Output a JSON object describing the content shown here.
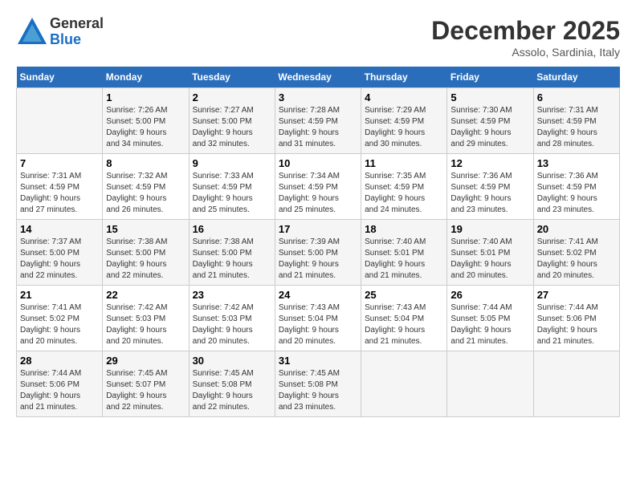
{
  "header": {
    "logo_general": "General",
    "logo_blue": "Blue",
    "month_title": "December 2025",
    "location": "Assolo, Sardinia, Italy"
  },
  "calendar": {
    "days_of_week": [
      "Sunday",
      "Monday",
      "Tuesday",
      "Wednesday",
      "Thursday",
      "Friday",
      "Saturday"
    ],
    "weeks": [
      [
        {
          "day": "",
          "info": ""
        },
        {
          "day": "1",
          "info": "Sunrise: 7:26 AM\nSunset: 5:00 PM\nDaylight: 9 hours\nand 34 minutes."
        },
        {
          "day": "2",
          "info": "Sunrise: 7:27 AM\nSunset: 5:00 PM\nDaylight: 9 hours\nand 32 minutes."
        },
        {
          "day": "3",
          "info": "Sunrise: 7:28 AM\nSunset: 4:59 PM\nDaylight: 9 hours\nand 31 minutes."
        },
        {
          "day": "4",
          "info": "Sunrise: 7:29 AM\nSunset: 4:59 PM\nDaylight: 9 hours\nand 30 minutes."
        },
        {
          "day": "5",
          "info": "Sunrise: 7:30 AM\nSunset: 4:59 PM\nDaylight: 9 hours\nand 29 minutes."
        },
        {
          "day": "6",
          "info": "Sunrise: 7:31 AM\nSunset: 4:59 PM\nDaylight: 9 hours\nand 28 minutes."
        }
      ],
      [
        {
          "day": "7",
          "info": "Sunrise: 7:31 AM\nSunset: 4:59 PM\nDaylight: 9 hours\nand 27 minutes."
        },
        {
          "day": "8",
          "info": "Sunrise: 7:32 AM\nSunset: 4:59 PM\nDaylight: 9 hours\nand 26 minutes."
        },
        {
          "day": "9",
          "info": "Sunrise: 7:33 AM\nSunset: 4:59 PM\nDaylight: 9 hours\nand 25 minutes."
        },
        {
          "day": "10",
          "info": "Sunrise: 7:34 AM\nSunset: 4:59 PM\nDaylight: 9 hours\nand 25 minutes."
        },
        {
          "day": "11",
          "info": "Sunrise: 7:35 AM\nSunset: 4:59 PM\nDaylight: 9 hours\nand 24 minutes."
        },
        {
          "day": "12",
          "info": "Sunrise: 7:36 AM\nSunset: 4:59 PM\nDaylight: 9 hours\nand 23 minutes."
        },
        {
          "day": "13",
          "info": "Sunrise: 7:36 AM\nSunset: 4:59 PM\nDaylight: 9 hours\nand 23 minutes."
        }
      ],
      [
        {
          "day": "14",
          "info": "Sunrise: 7:37 AM\nSunset: 5:00 PM\nDaylight: 9 hours\nand 22 minutes."
        },
        {
          "day": "15",
          "info": "Sunrise: 7:38 AM\nSunset: 5:00 PM\nDaylight: 9 hours\nand 22 minutes."
        },
        {
          "day": "16",
          "info": "Sunrise: 7:38 AM\nSunset: 5:00 PM\nDaylight: 9 hours\nand 21 minutes."
        },
        {
          "day": "17",
          "info": "Sunrise: 7:39 AM\nSunset: 5:00 PM\nDaylight: 9 hours\nand 21 minutes."
        },
        {
          "day": "18",
          "info": "Sunrise: 7:40 AM\nSunset: 5:01 PM\nDaylight: 9 hours\nand 21 minutes."
        },
        {
          "day": "19",
          "info": "Sunrise: 7:40 AM\nSunset: 5:01 PM\nDaylight: 9 hours\nand 20 minutes."
        },
        {
          "day": "20",
          "info": "Sunrise: 7:41 AM\nSunset: 5:02 PM\nDaylight: 9 hours\nand 20 minutes."
        }
      ],
      [
        {
          "day": "21",
          "info": "Sunrise: 7:41 AM\nSunset: 5:02 PM\nDaylight: 9 hours\nand 20 minutes."
        },
        {
          "day": "22",
          "info": "Sunrise: 7:42 AM\nSunset: 5:03 PM\nDaylight: 9 hours\nand 20 minutes."
        },
        {
          "day": "23",
          "info": "Sunrise: 7:42 AM\nSunset: 5:03 PM\nDaylight: 9 hours\nand 20 minutes."
        },
        {
          "day": "24",
          "info": "Sunrise: 7:43 AM\nSunset: 5:04 PM\nDaylight: 9 hours\nand 20 minutes."
        },
        {
          "day": "25",
          "info": "Sunrise: 7:43 AM\nSunset: 5:04 PM\nDaylight: 9 hours\nand 21 minutes."
        },
        {
          "day": "26",
          "info": "Sunrise: 7:44 AM\nSunset: 5:05 PM\nDaylight: 9 hours\nand 21 minutes."
        },
        {
          "day": "27",
          "info": "Sunrise: 7:44 AM\nSunset: 5:06 PM\nDaylight: 9 hours\nand 21 minutes."
        }
      ],
      [
        {
          "day": "28",
          "info": "Sunrise: 7:44 AM\nSunset: 5:06 PM\nDaylight: 9 hours\nand 21 minutes."
        },
        {
          "day": "29",
          "info": "Sunrise: 7:45 AM\nSunset: 5:07 PM\nDaylight: 9 hours\nand 22 minutes."
        },
        {
          "day": "30",
          "info": "Sunrise: 7:45 AM\nSunset: 5:08 PM\nDaylight: 9 hours\nand 22 minutes."
        },
        {
          "day": "31",
          "info": "Sunrise: 7:45 AM\nSunset: 5:08 PM\nDaylight: 9 hours\nand 23 minutes."
        },
        {
          "day": "",
          "info": ""
        },
        {
          "day": "",
          "info": ""
        },
        {
          "day": "",
          "info": ""
        }
      ]
    ]
  }
}
